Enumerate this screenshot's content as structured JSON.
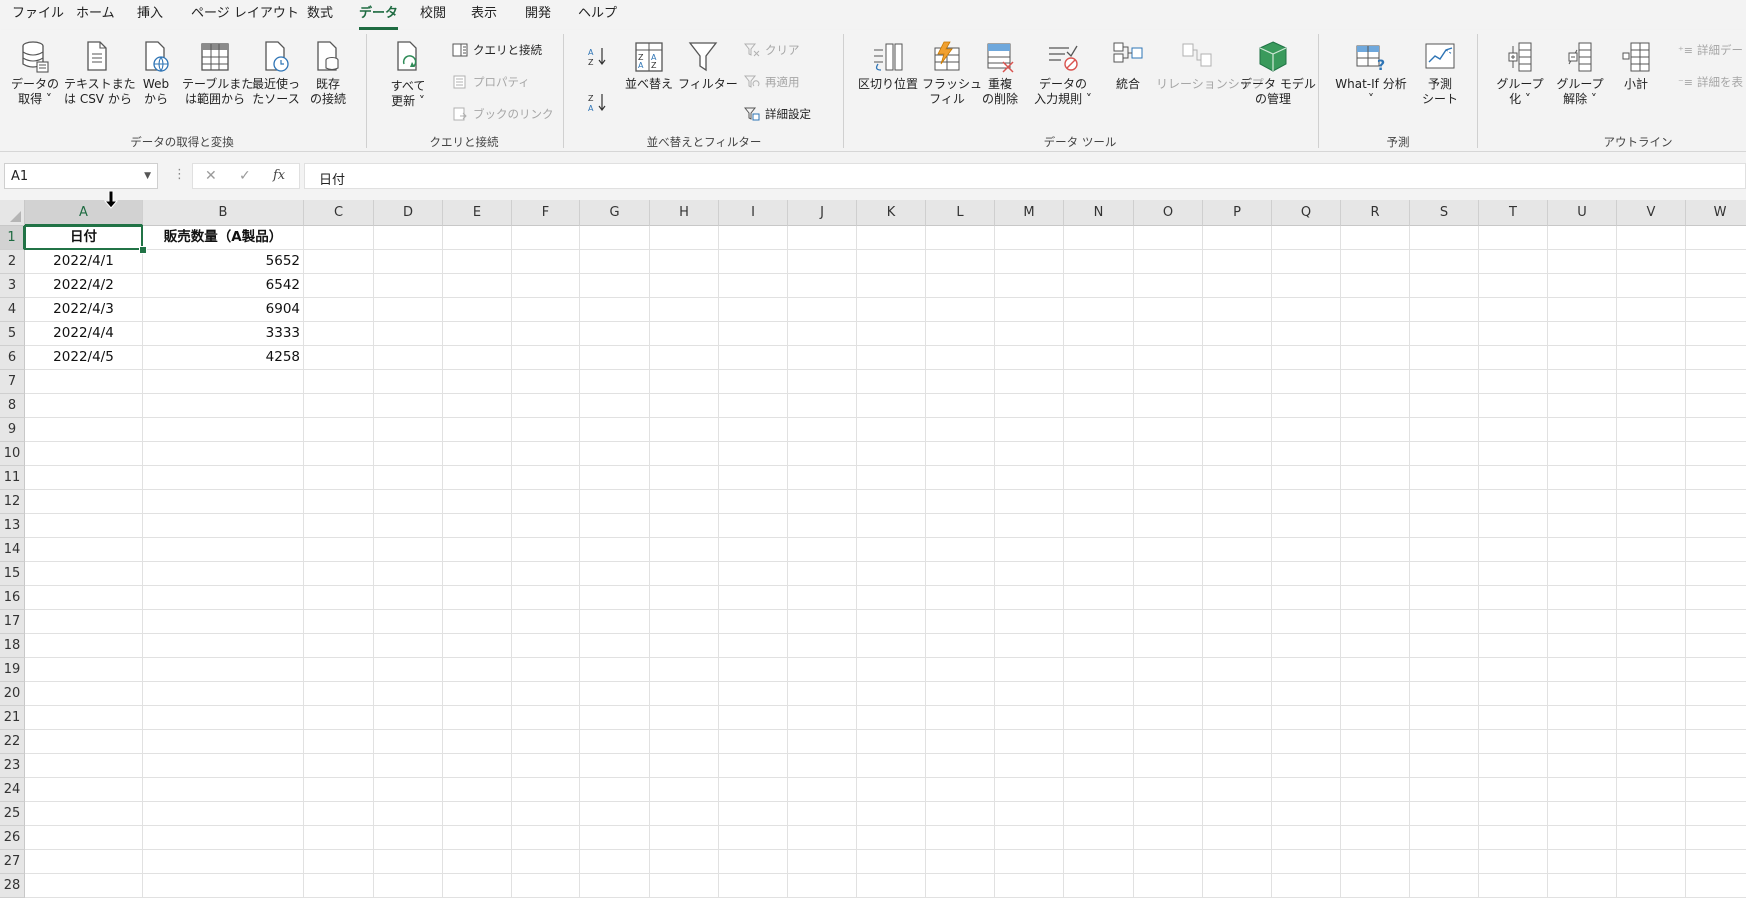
{
  "menu": {
    "tabs": [
      {
        "label": "ファイル",
        "active": false
      },
      {
        "label": "ホーム",
        "active": false
      },
      {
        "label": "挿入",
        "active": false
      },
      {
        "label": "ページ レイアウト",
        "active": false
      },
      {
        "label": "数式",
        "active": false
      },
      {
        "label": "データ",
        "active": true
      },
      {
        "label": "校閲",
        "active": false
      },
      {
        "label": "表示",
        "active": false
      },
      {
        "label": "開発",
        "active": false
      },
      {
        "label": "ヘルプ",
        "active": false
      }
    ]
  },
  "ribbon": {
    "get_data": {
      "group_label": "データの取得と変換",
      "get_data": {
        "line1": "データの",
        "line2": "取得 ˅"
      },
      "text_csv": {
        "line1": "テキストまた",
        "line2": "は CSV から"
      },
      "web": {
        "line1": "Web",
        "line2": "から"
      },
      "table_range": {
        "line1": "テーブルまた",
        "line2": "は範囲から"
      },
      "recent_sources": {
        "line1": "最近使っ",
        "line2": "たソース"
      },
      "existing_conn": {
        "line1": "既存",
        "line2": "の接続"
      }
    },
    "queries": {
      "group_label": "クエリと接続",
      "refresh_all": {
        "line1": "すべて",
        "line2": "更新 ˅"
      },
      "queries_connections": "クエリと接続",
      "properties": "プロパティ",
      "edit_links": "ブックのリンク"
    },
    "sort_filter": {
      "group_label": "並べ替えとフィルター",
      "sort_az": "A→Z",
      "sort_za": "Z→A",
      "sort": "並べ替え",
      "filter": "フィルター",
      "clear": "クリア",
      "reapply": "再適用",
      "advanced": "詳細設定"
    },
    "data_tools": {
      "group_label": "データ ツール",
      "text_to_columns": "区切り位置",
      "flash_fill": {
        "line1": "フラッシュ",
        "line2": "フィル"
      },
      "remove_duplicates": {
        "line1": "重複",
        "line2": "の削除"
      },
      "data_validation": {
        "line1": "データの",
        "line2": "入力規則 ˅"
      },
      "consolidate": "統合",
      "relationships": "リレーションシップ",
      "data_model": {
        "line1": "データ モデル",
        "line2": "の管理"
      }
    },
    "forecast": {
      "group_label": "予測",
      "what_if": {
        "line1": "What-If 分析",
        "line2": "˅"
      },
      "forecast_sheet": {
        "line1": "予測",
        "line2": "シート"
      }
    },
    "outline": {
      "group_label": "アウトライン",
      "group": {
        "line1": "グループ",
        "line2": "化 ˅"
      },
      "ungroup": {
        "line1": "グループ",
        "line2": "解除 ˅"
      },
      "subtotal": "小計",
      "show_detail": "詳細デー",
      "hide_detail": "詳細を表"
    }
  },
  "formula_bar": {
    "name_box": "A1",
    "dots": "⋮",
    "cancel": "✕",
    "enter": "✓",
    "fx": "fx",
    "formula": "日付"
  },
  "colors": {
    "accent": "#217346",
    "tab_active": "#1e6b41"
  },
  "grid": {
    "columns": [
      "A",
      "B",
      "C",
      "D",
      "E",
      "F",
      "G",
      "H",
      "I",
      "J",
      "K",
      "L",
      "M",
      "N",
      "O",
      "P",
      "Q",
      "R",
      "S",
      "T",
      "U",
      "V",
      "W"
    ],
    "rows": [
      "1",
      "2",
      "3",
      "4",
      "5",
      "6",
      "7",
      "8",
      "9",
      "10",
      "11",
      "12",
      "13",
      "14",
      "15",
      "16",
      "17",
      "18",
      "19",
      "20",
      "21",
      "22",
      "23",
      "24",
      "25",
      "26",
      "27",
      "28"
    ],
    "selected_cell": "A1",
    "data": [
      [
        "日付",
        "販売数量（A製品）"
      ],
      [
        "2022/4/1",
        "5652"
      ],
      [
        "2022/4/2",
        "6542"
      ],
      [
        "2022/4/3",
        "6904"
      ],
      [
        "2022/4/4",
        "3333"
      ],
      [
        "2022/4/5",
        "4258"
      ]
    ]
  }
}
